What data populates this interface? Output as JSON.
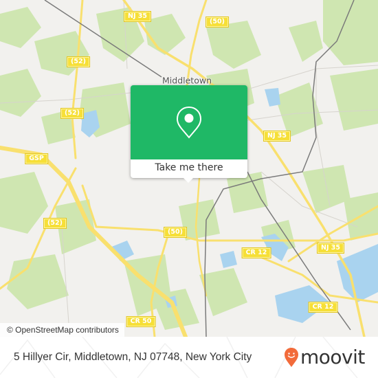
{
  "map": {
    "town_label": "Middletown",
    "shields": [
      {
        "label": "NJ 35",
        "id": "nj35-north"
      },
      {
        "label": "(50)",
        "id": "route50-north"
      },
      {
        "label": "(52)",
        "id": "route52-north"
      },
      {
        "label": "(52)",
        "id": "route52-mid"
      },
      {
        "label": "GSP",
        "id": "gsp"
      },
      {
        "label": "NJ 35",
        "id": "nj35-mid"
      },
      {
        "label": "(52)",
        "id": "route52-south"
      },
      {
        "label": "(50)",
        "id": "route50-south"
      },
      {
        "label": "CR 12",
        "id": "cr12-west"
      },
      {
        "label": "NJ 35",
        "id": "nj35-east"
      },
      {
        "label": "CR 12",
        "id": "cr12-east"
      },
      {
        "label": "CR 50",
        "id": "cr50"
      }
    ],
    "attribution": "© OpenStreetMap contributors"
  },
  "popup": {
    "icon": "map-pin-icon",
    "button_label": "Take me there",
    "color": "#1fb866"
  },
  "footer": {
    "address": "5 Hillyer Cir, Middletown, NJ 07748, New York City",
    "brand": "moovit",
    "brand_color": "#f26b3a"
  }
}
